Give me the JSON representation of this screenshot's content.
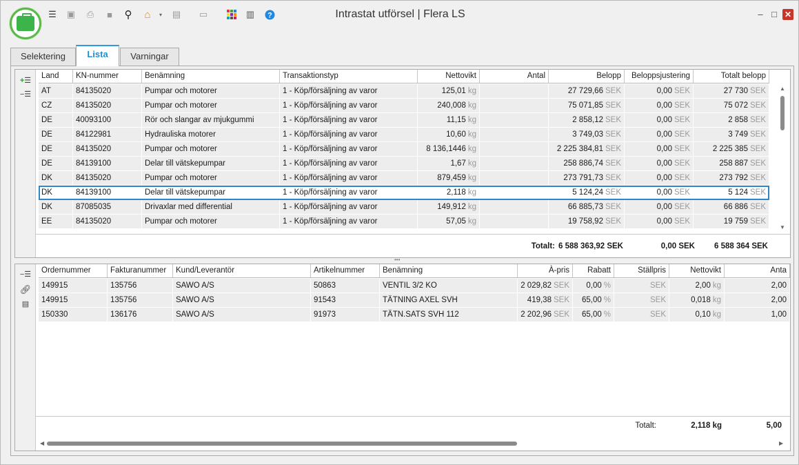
{
  "window": {
    "title": "Intrastat utförsel | Flera LS"
  },
  "tabs": [
    {
      "label": "Selektering"
    },
    {
      "label": "Lista"
    },
    {
      "label": "Varningar"
    }
  ],
  "top_grid": {
    "columns": [
      "Land",
      "KN-nummer",
      "Benämning",
      "Transaktionstyp",
      "Nettovikt",
      "Antal",
      "Belopp",
      "Beloppsjustering",
      "Totalt belopp"
    ],
    "rows": [
      [
        "AT",
        "84135020",
        "Pumpar och motorer",
        "1 - Köp/försäljning av varor",
        "125,01",
        "kg",
        "",
        "27 729,66",
        "SEK",
        "0,00",
        "SEK",
        "27 730",
        "SEK"
      ],
      [
        "CZ",
        "84135020",
        "Pumpar och motorer",
        "1 - Köp/försäljning av varor",
        "240,008",
        "kg",
        "",
        "75 071,85",
        "SEK",
        "0,00",
        "SEK",
        "75 072",
        "SEK"
      ],
      [
        "DE",
        "40093100",
        "Rör och slangar av mjukgummi",
        "1 - Köp/försäljning av varor",
        "11,15",
        "kg",
        "",
        "2 858,12",
        "SEK",
        "0,00",
        "SEK",
        "2 858",
        "SEK"
      ],
      [
        "DE",
        "84122981",
        "Hydrauliska motorer",
        "1 - Köp/försäljning av varor",
        "10,60",
        "kg",
        "",
        "3 749,03",
        "SEK",
        "0,00",
        "SEK",
        "3 749",
        "SEK"
      ],
      [
        "DE",
        "84135020",
        "Pumpar och motorer",
        "1 - Köp/försäljning av varor",
        "8 136,1446",
        "kg",
        "",
        "2 225 384,81",
        "SEK",
        "0,00",
        "SEK",
        "2 225 385",
        "SEK"
      ],
      [
        "DE",
        "84139100",
        "Delar till vätskepumpar",
        "1 - Köp/försäljning av varor",
        "1,67",
        "kg",
        "",
        "258 886,74",
        "SEK",
        "0,00",
        "SEK",
        "258 887",
        "SEK"
      ],
      [
        "DK",
        "84135020",
        "Pumpar och motorer",
        "1 - Köp/försäljning av varor",
        "879,459",
        "kg",
        "",
        "273 791,73",
        "SEK",
        "0,00",
        "SEK",
        "273 792",
        "SEK"
      ],
      [
        "DK",
        "84139100",
        "Delar till vätskepumpar",
        "1 - Köp/försäljning av varor",
        "2,118",
        "kg",
        "",
        "5 124,24",
        "SEK",
        "0,00",
        "SEK",
        "5 124",
        "SEK"
      ],
      [
        "DK",
        "87085035",
        "Drivaxlar med differential",
        "1 - Köp/försäljning av varor",
        "149,912",
        "kg",
        "",
        "66 885,73",
        "SEK",
        "0,00",
        "SEK",
        "66 886",
        "SEK"
      ],
      [
        "EE",
        "84135020",
        "Pumpar och motorer",
        "1 - Köp/försäljning av varor",
        "57,05",
        "kg",
        "",
        "19 758,92",
        "SEK",
        "0,00",
        "SEK",
        "19 759",
        "SEK"
      ]
    ],
    "selected_row": 7,
    "totals": {
      "label": "Totalt:",
      "belopp": "6 588 363,92 SEK",
      "justering": "0,00 SEK",
      "totalt": "6 588 364 SEK"
    }
  },
  "bottom_grid": {
    "columns": [
      "Ordernummer",
      "Fakturanummer",
      "Kund/Leverantör",
      "Artikelnummer",
      "Benämning",
      "À-pris",
      "Rabatt",
      "Ställpris",
      "Nettovikt",
      "Anta"
    ],
    "rows": [
      [
        "149915",
        "135756",
        "SAWO A/S",
        "50863",
        "VENTIL 3/2 KO",
        "2 029,82",
        "SEK",
        "0,00",
        "%",
        "SEK",
        "2,00",
        "kg",
        "2,00"
      ],
      [
        "149915",
        "135756",
        "SAWO A/S",
        "91543",
        "TÄTNING AXEL SVH",
        "419,38",
        "SEK",
        "65,00",
        "%",
        "SEK",
        "0,018",
        "kg",
        "2,00"
      ],
      [
        "150330",
        "136176",
        "SAWO A/S",
        "91973",
        "TÄTN.SATS SVH 112",
        "2 202,96",
        "SEK",
        "65,00",
        "%",
        "SEK",
        "0,10",
        "kg",
        "1,00"
      ]
    ],
    "totals": {
      "label": "Totalt:",
      "nettovikt": "2,118 kg",
      "antal": "5,00"
    }
  },
  "splitter": "•••",
  "icons": {
    "toolbar": [
      "list-icon",
      "save-icon",
      "print-icon",
      "stop-icon",
      "search-icon",
      "home-icon",
      "calculator-icon",
      "window-icon",
      "grid-icon",
      "book-icon",
      "help-icon"
    ]
  }
}
